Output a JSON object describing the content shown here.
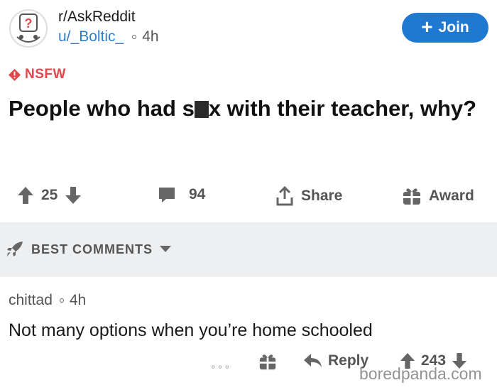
{
  "post": {
    "subreddit": "r/AskReddit",
    "username": "u/_Boltic_",
    "time": "4h",
    "join_label": "Join",
    "nsfw_label": "NSFW",
    "title_part1": "People who had s",
    "title_part2": "x with their teacher, why?",
    "upvotes": "25",
    "comments": "94",
    "share_label": "Share",
    "award_label": "Award"
  },
  "best_comments": {
    "label": "BEST COMMENTS"
  },
  "comment": {
    "author": "chittad",
    "time": "4h",
    "text": "Not many options when you’re home schooled",
    "reply_label": "Reply",
    "score": "243"
  },
  "watermark": "boredpanda.com",
  "colors": {
    "accent": "#1f79d1",
    "nsfw": "#e0474c",
    "bar_bg": "#edeff1"
  },
  "icons": [
    "subreddit-avatar-icon",
    "plus-icon",
    "nsfw-icon",
    "upvote-icon",
    "downvote-icon",
    "comment-icon",
    "share-icon",
    "award-icon",
    "rocket-icon",
    "chevron-down-icon",
    "reply-icon",
    "more-icon"
  ]
}
